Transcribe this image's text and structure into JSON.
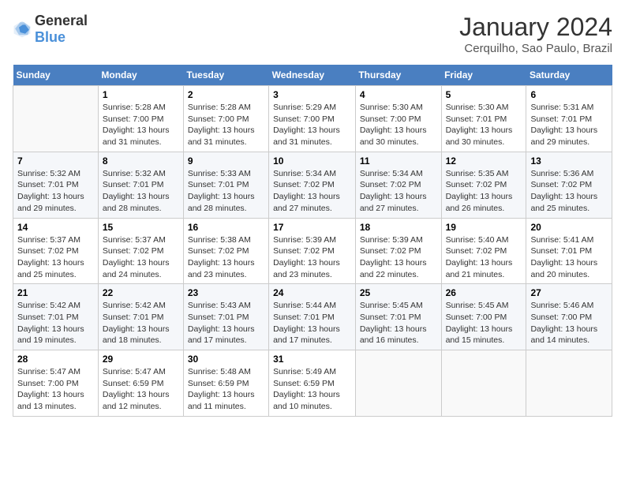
{
  "header": {
    "logo_general": "General",
    "logo_blue": "Blue",
    "title": "January 2024",
    "subtitle": "Cerquilho, Sao Paulo, Brazil"
  },
  "columns": [
    "Sunday",
    "Monday",
    "Tuesday",
    "Wednesday",
    "Thursday",
    "Friday",
    "Saturday"
  ],
  "weeks": [
    [
      {
        "num": "",
        "info": ""
      },
      {
        "num": "1",
        "info": "Sunrise: 5:28 AM\nSunset: 7:00 PM\nDaylight: 13 hours\nand 31 minutes."
      },
      {
        "num": "2",
        "info": "Sunrise: 5:28 AM\nSunset: 7:00 PM\nDaylight: 13 hours\nand 31 minutes."
      },
      {
        "num": "3",
        "info": "Sunrise: 5:29 AM\nSunset: 7:00 PM\nDaylight: 13 hours\nand 31 minutes."
      },
      {
        "num": "4",
        "info": "Sunrise: 5:30 AM\nSunset: 7:00 PM\nDaylight: 13 hours\nand 30 minutes."
      },
      {
        "num": "5",
        "info": "Sunrise: 5:30 AM\nSunset: 7:01 PM\nDaylight: 13 hours\nand 30 minutes."
      },
      {
        "num": "6",
        "info": "Sunrise: 5:31 AM\nSunset: 7:01 PM\nDaylight: 13 hours\nand 29 minutes."
      }
    ],
    [
      {
        "num": "7",
        "info": "Sunrise: 5:32 AM\nSunset: 7:01 PM\nDaylight: 13 hours\nand 29 minutes."
      },
      {
        "num": "8",
        "info": "Sunrise: 5:32 AM\nSunset: 7:01 PM\nDaylight: 13 hours\nand 28 minutes."
      },
      {
        "num": "9",
        "info": "Sunrise: 5:33 AM\nSunset: 7:01 PM\nDaylight: 13 hours\nand 28 minutes."
      },
      {
        "num": "10",
        "info": "Sunrise: 5:34 AM\nSunset: 7:02 PM\nDaylight: 13 hours\nand 27 minutes."
      },
      {
        "num": "11",
        "info": "Sunrise: 5:34 AM\nSunset: 7:02 PM\nDaylight: 13 hours\nand 27 minutes."
      },
      {
        "num": "12",
        "info": "Sunrise: 5:35 AM\nSunset: 7:02 PM\nDaylight: 13 hours\nand 26 minutes."
      },
      {
        "num": "13",
        "info": "Sunrise: 5:36 AM\nSunset: 7:02 PM\nDaylight: 13 hours\nand 25 minutes."
      }
    ],
    [
      {
        "num": "14",
        "info": "Sunrise: 5:37 AM\nSunset: 7:02 PM\nDaylight: 13 hours\nand 25 minutes."
      },
      {
        "num": "15",
        "info": "Sunrise: 5:37 AM\nSunset: 7:02 PM\nDaylight: 13 hours\nand 24 minutes."
      },
      {
        "num": "16",
        "info": "Sunrise: 5:38 AM\nSunset: 7:02 PM\nDaylight: 13 hours\nand 23 minutes."
      },
      {
        "num": "17",
        "info": "Sunrise: 5:39 AM\nSunset: 7:02 PM\nDaylight: 13 hours\nand 23 minutes."
      },
      {
        "num": "18",
        "info": "Sunrise: 5:39 AM\nSunset: 7:02 PM\nDaylight: 13 hours\nand 22 minutes."
      },
      {
        "num": "19",
        "info": "Sunrise: 5:40 AM\nSunset: 7:02 PM\nDaylight: 13 hours\nand 21 minutes."
      },
      {
        "num": "20",
        "info": "Sunrise: 5:41 AM\nSunset: 7:01 PM\nDaylight: 13 hours\nand 20 minutes."
      }
    ],
    [
      {
        "num": "21",
        "info": "Sunrise: 5:42 AM\nSunset: 7:01 PM\nDaylight: 13 hours\nand 19 minutes."
      },
      {
        "num": "22",
        "info": "Sunrise: 5:42 AM\nSunset: 7:01 PM\nDaylight: 13 hours\nand 18 minutes."
      },
      {
        "num": "23",
        "info": "Sunrise: 5:43 AM\nSunset: 7:01 PM\nDaylight: 13 hours\nand 17 minutes."
      },
      {
        "num": "24",
        "info": "Sunrise: 5:44 AM\nSunset: 7:01 PM\nDaylight: 13 hours\nand 17 minutes."
      },
      {
        "num": "25",
        "info": "Sunrise: 5:45 AM\nSunset: 7:01 PM\nDaylight: 13 hours\nand 16 minutes."
      },
      {
        "num": "26",
        "info": "Sunrise: 5:45 AM\nSunset: 7:00 PM\nDaylight: 13 hours\nand 15 minutes."
      },
      {
        "num": "27",
        "info": "Sunrise: 5:46 AM\nSunset: 7:00 PM\nDaylight: 13 hours\nand 14 minutes."
      }
    ],
    [
      {
        "num": "28",
        "info": "Sunrise: 5:47 AM\nSunset: 7:00 PM\nDaylight: 13 hours\nand 13 minutes."
      },
      {
        "num": "29",
        "info": "Sunrise: 5:47 AM\nSunset: 6:59 PM\nDaylight: 13 hours\nand 12 minutes."
      },
      {
        "num": "30",
        "info": "Sunrise: 5:48 AM\nSunset: 6:59 PM\nDaylight: 13 hours\nand 11 minutes."
      },
      {
        "num": "31",
        "info": "Sunrise: 5:49 AM\nSunset: 6:59 PM\nDaylight: 13 hours\nand 10 minutes."
      },
      {
        "num": "",
        "info": ""
      },
      {
        "num": "",
        "info": ""
      },
      {
        "num": "",
        "info": ""
      }
    ]
  ]
}
